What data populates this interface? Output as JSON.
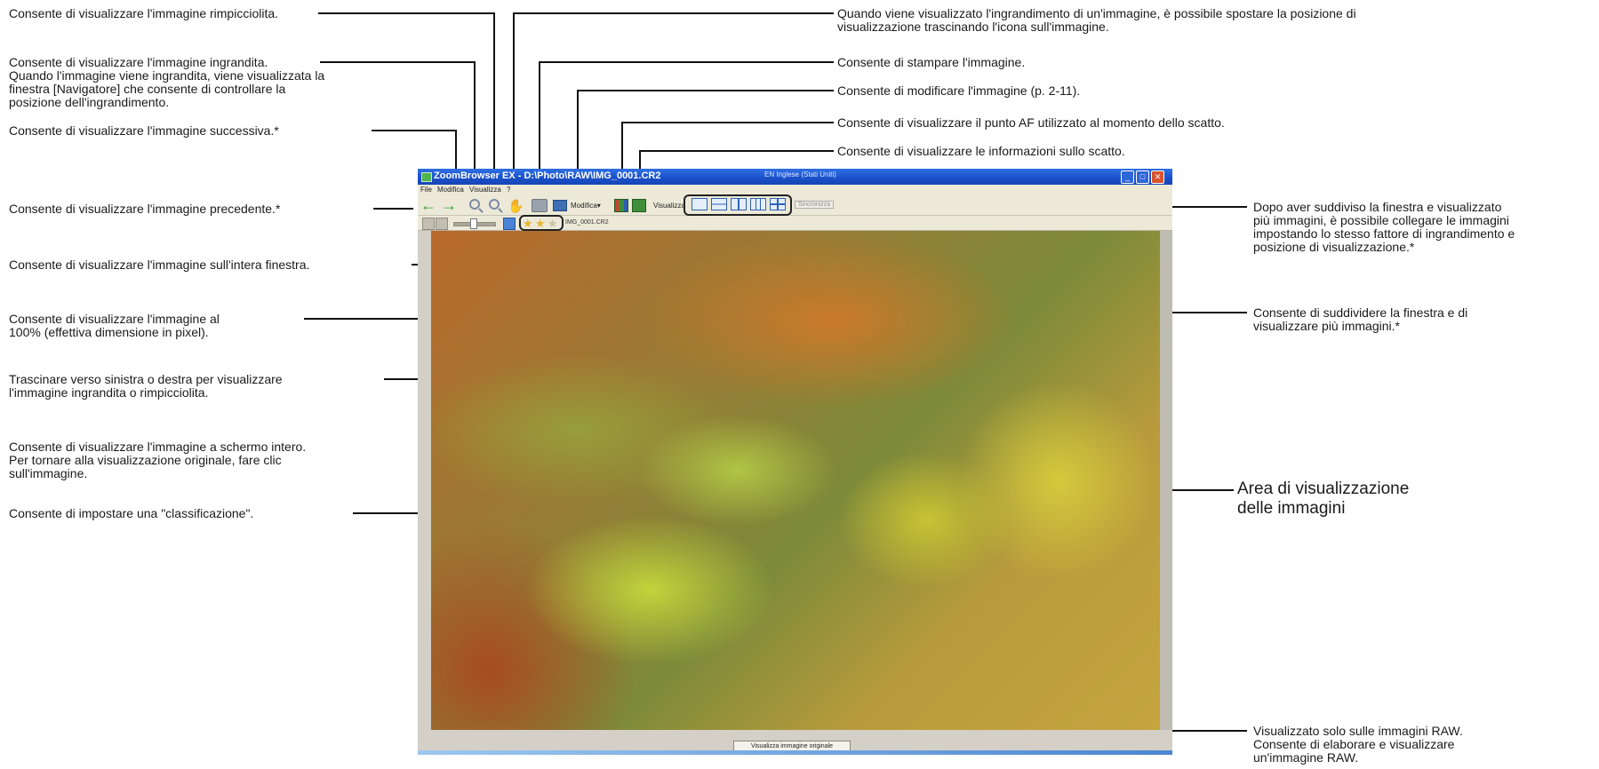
{
  "window": {
    "title": "ZoomBrowser EX - D:\\Photo\\RAW\\IMG_0001.CR2",
    "language": "EN Inglese (Stati Uniti)",
    "menu": [
      "File",
      "Modifica",
      "Visualizza",
      "?"
    ],
    "toolbar": {
      "modifica_label": "Modifica",
      "visualizza_label": "Visualizza",
      "sincronizza_label": "Sincronizza"
    },
    "filename": "IMG_0001.CR2",
    "raw_button_label": "Visualizza immagine originale"
  },
  "callouts": {
    "zoom_out": "Consente di visualizzare l'immagine rimpicciolita.",
    "zoom_in": [
      "Consente di visualizzare l'immagine ingrandita.",
      "Quando l'immagine viene ingrandita, viene visualizzata la",
      "finestra [Navigatore] che consente di controllare la",
      "posizione dell'ingrandimento."
    ],
    "next_image": "Consente di visualizzare l'immagine successiva.*",
    "prev_image": "Consente di visualizzare l'immagine precedente.*",
    "fit_window": "Consente di visualizzare l'immagine sull'intera finestra.",
    "actual_size": [
      "Consente di visualizzare l'immagine al",
      "100% (effettiva dimensione in pixel)."
    ],
    "zoom_slider": [
      "Trascinare verso sinistra o destra per visualizzare",
      "l'immagine ingrandita o rimpicciolita."
    ],
    "full_screen": [
      "Consente di visualizzare l'immagine a schermo intero.",
      "Per tornare alla visualizzazione originale, fare clic",
      "sull'immagine."
    ],
    "rating": "Consente di impostare una \"classificazione\".",
    "hand_tool": [
      "Quando viene visualizzato l'ingrandimento di un'immagine, è possibile spostare la posizione di",
      "visualizzazione trascinando l'icona sull'immagine."
    ],
    "print": "Consente di stampare l'immagine.",
    "edit": "Consente di modificare l'immagine (p. 2-11).",
    "af_point": "Consente di visualizzare il punto AF utilizzato al momento dello scatto.",
    "shooting_info": "Consente di visualizzare le informazioni sullo scatto.",
    "sync": [
      "Dopo aver suddiviso la finestra e visualizzato",
      "più immagini, è possibile collegare le immagini",
      "impostando lo stesso fattore di ingrandimento e",
      "posizione di visualizzazione.*"
    ],
    "split": [
      "Consente di suddividere la finestra e di",
      "visualizzare più immagini.*"
    ],
    "image_area": [
      "Area di visualizzazione",
      "delle immagini"
    ],
    "raw_only": [
      "Visualizzato solo sulle immagini RAW.",
      "Consente di elaborare e visualizzare",
      "un'immagine RAW."
    ]
  }
}
